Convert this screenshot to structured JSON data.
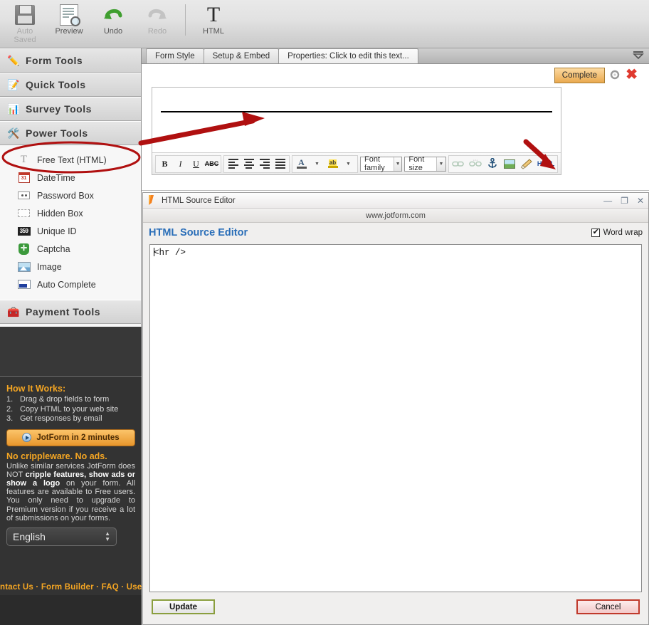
{
  "toolbar": {
    "items": [
      {
        "label": "Auto\nSaved",
        "label1": "Auto",
        "label2": "Saved",
        "icon": "floppy-disk-icon",
        "disabled": true
      },
      {
        "label": "Preview",
        "icon": "preview-magnifier-icon",
        "disabled": false
      },
      {
        "label": "Undo",
        "icon": "undo-arrow-icon",
        "disabled": false
      },
      {
        "label": "Redo",
        "icon": "redo-arrow-icon",
        "disabled": true
      },
      {
        "label": "HTML",
        "icon": "text-t-icon",
        "disabled": false
      }
    ],
    "auto_label": "Auto",
    "saved_label": "Saved",
    "preview_label": "Preview",
    "undo_label": "Undo",
    "redo_label": "Redo",
    "html_label": "HTML"
  },
  "sidebar": {
    "categories": [
      {
        "label": "Form Tools",
        "icon": "pencil-icon"
      },
      {
        "label": "Quick Tools",
        "icon": "pencil-paper-icon"
      },
      {
        "label": "Survey Tools",
        "icon": "bar-chart-icon"
      },
      {
        "label": "Power Tools",
        "icon": "tools-icon"
      }
    ],
    "cat_form_tools": "Form Tools",
    "cat_quick_tools": "Quick Tools",
    "cat_survey_tools": "Survey Tools",
    "cat_power_tools": "Power Tools",
    "cat_payment_tools": "Payment Tools",
    "power_tools_items": [
      {
        "label": "Free Text (HTML)",
        "icon": "free-text-icon",
        "highlighted": true
      },
      {
        "label": "DateTime",
        "icon": "calendar-icon"
      },
      {
        "label": "Password Box",
        "icon": "password-box-icon"
      },
      {
        "label": "Hidden Box",
        "icon": "hidden-box-icon"
      },
      {
        "label": "Unique ID",
        "icon": "unique-id-icon"
      },
      {
        "label": "Captcha",
        "icon": "shield-icon"
      },
      {
        "label": "Image",
        "icon": "image-icon"
      },
      {
        "label": "Auto Complete",
        "icon": "auto-complete-icon"
      }
    ],
    "unique_id_glyph": "359"
  },
  "promo": {
    "how_it_works_title": "How It Works:",
    "steps": [
      {
        "num": "1.",
        "text": "Drag & drop fields to form"
      },
      {
        "num": "2.",
        "text": "Copy HTML to your web site"
      },
      {
        "num": "3.",
        "text": "Get responses by email"
      }
    ],
    "cta_label": "JotForm in 2 minutes",
    "cta_icon": "play-button-icon",
    "no_crippleware_title": "No crippleware. No ads.",
    "body_parts": [
      {
        "text": "Unlike similar services JotForm does NOT ",
        "bold": false
      },
      {
        "text": "cripple features, show ads or show a logo",
        "bold": true
      },
      {
        "text": " on your form. All features are available to Free users. You only need to upgrade to Premium version if you receive a lot of submissions on your forms.",
        "bold": false
      }
    ],
    "body_text": "Unlike similar services JotForm does NOT cripple features, show ads or show a logo on your form. All features are available to Free users. You only need to upgrade to Premium version if you receive a lot of submissions on your forms.",
    "language_value": "English",
    "links": [
      "ntact Us",
      "Form Builder",
      "FAQ",
      "User"
    ],
    "links_text": "ntact Us · Form Builder · FAQ · User"
  },
  "form_builder": {
    "tabs": [
      {
        "label": "Form Style",
        "active": false
      },
      {
        "label": "Setup & Embed",
        "active": false
      },
      {
        "label": "Properties: Click to edit this text...",
        "active": true
      }
    ],
    "collapse_icon": "collapse-icon",
    "complete_label": "Complete",
    "gear_icon": "gear-icon",
    "close_icon": "close-x-icon",
    "editor_content": "",
    "rte": {
      "bold": "B",
      "italic": "I",
      "underline": "U",
      "strike": "ABC",
      "align_left": "align-left-icon",
      "align_center": "align-center-icon",
      "align_right": "align-right-icon",
      "align_justify": "align-justify-icon",
      "text_color": "A",
      "highlight": "ab",
      "font_family_placeholder": "Font family",
      "font_size_placeholder": "Font size",
      "link_icon": "link-icon",
      "unlink_icon": "unlink-icon",
      "anchor_icon": "anchor-icon",
      "image_icon": "insert-image-icon",
      "cleanup_icon": "broom-icon",
      "html_label": "HTML"
    }
  },
  "source_editor": {
    "window_title": "HTML Source Editor",
    "window_icon": "jotform-logo-icon",
    "minimize_icon": "minimize-icon",
    "maximize_icon": "maximize-icon",
    "close_icon": "close-icon",
    "url": "www.jotform.com",
    "heading": "HTML Source Editor",
    "word_wrap_label": "Word wrap",
    "word_wrap_checked": true,
    "code": "<hr />",
    "update_label": "Update",
    "cancel_label": "Cancel"
  },
  "colors": {
    "accent_orange": "#f5a623",
    "highlight_red": "#b01010",
    "link_blue": "#2a6eb8",
    "sidebar_bg": "#f6f6f6",
    "promo_bg": "#333333",
    "complete_btn": "#eaa94f"
  }
}
